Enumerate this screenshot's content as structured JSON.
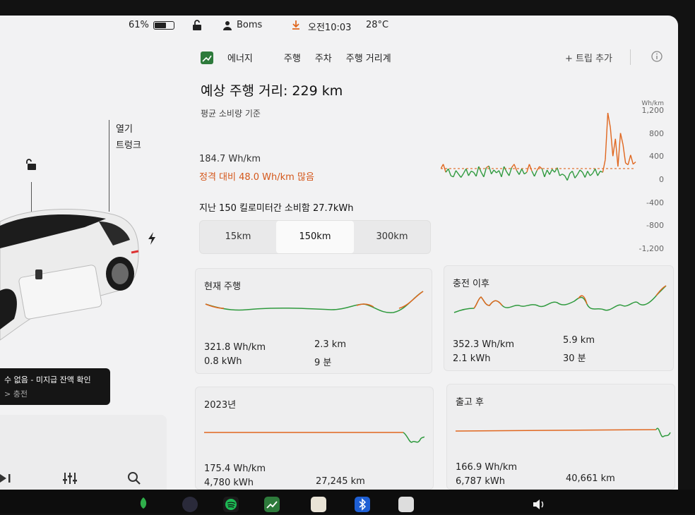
{
  "status": {
    "battery_percent": "61%",
    "battery_level": 0.61,
    "user": "Boms",
    "time": "오전10:03",
    "temperature": "28°C"
  },
  "left": {
    "open_label": "열기",
    "trunk_label": "트렁크",
    "notice_line1": "수 없음 - 미지급 잔액 확인",
    "notice_line2": "> 충전"
  },
  "tabs": {
    "energy": "에너지",
    "drive": "주행",
    "park": "주차",
    "distance": "주행 거리계",
    "add_trip": "+ 트립 추가"
  },
  "summary": {
    "range_title": "예상 주행 거리: 229 km",
    "subtitle": "평균 소비량 기준",
    "consumption": "184.7 Wh/km",
    "delta": "정격 대비 48.0 Wh/km 많음",
    "last_label": "지난 150 킬로미터간 소비함 27.7kWh"
  },
  "segments": {
    "items": [
      "15km",
      "150km",
      "300km"
    ],
    "active_index": 1
  },
  "chart_data": {
    "type": "line",
    "title": "",
    "ylabel": "Wh/km",
    "yticks": [
      "1,200",
      "800",
      "400",
      "0",
      "-400",
      "-800",
      "-1,200"
    ],
    "ylim": [
      -1200,
      1200
    ],
    "average_line": 184.7,
    "series": [
      {
        "values": [
          180,
          260,
          120,
          180,
          60,
          40,
          150,
          90,
          30,
          100,
          180,
          60,
          140,
          120,
          50,
          220,
          120,
          40,
          200,
          230,
          90,
          160,
          110,
          150,
          40,
          220,
          130,
          60,
          200,
          260,
          150,
          80,
          180,
          90,
          120,
          260,
          140,
          50,
          150,
          220,
          180,
          40,
          160,
          80,
          170,
          120,
          200,
          60,
          90,
          60,
          -20,
          100,
          140,
          20,
          80,
          160,
          120,
          30,
          140,
          60,
          100,
          180,
          60,
          140,
          120,
          340,
          1150,
          900,
          400,
          700,
          220,
          800,
          600,
          280,
          250,
          420,
          260,
          300
        ]
      }
    ]
  },
  "cards": {
    "current": {
      "title": "현재 주행",
      "consumption": "321.8 Wh/km",
      "energy": "0.8 kWh",
      "distance": "2.3 km",
      "time": "9 분"
    },
    "since_charge": {
      "title": "충전 이후",
      "consumption": "352.3 Wh/km",
      "energy": "2.1 kWh",
      "distance": "5.9 km",
      "time": "30 분"
    },
    "year": {
      "title": "2023년",
      "consumption": "175.4 Wh/km",
      "energy": "4,780 kWh",
      "distance": "27,245 km"
    },
    "delivery": {
      "title": "출고 후",
      "consumption": "166.9 Wh/km",
      "energy": "6,787 kWh",
      "distance": "40,661 km"
    }
  },
  "colors": {
    "accent_orange": "#e0671f",
    "green": "#2f9a3e",
    "delta_text": "#d4571a"
  }
}
